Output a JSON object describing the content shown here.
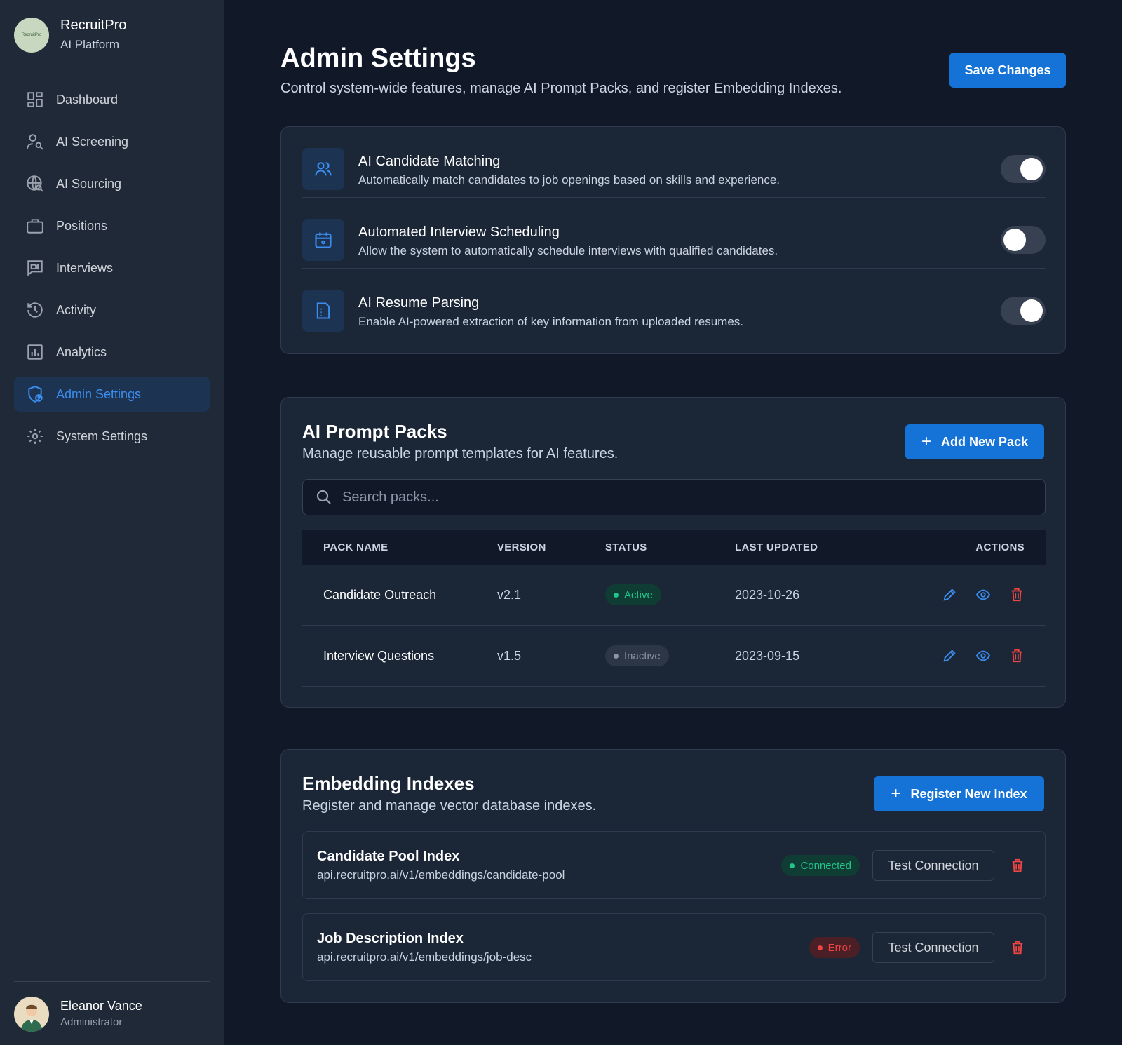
{
  "brand": {
    "logo_text": "RecruitPro",
    "name": "RecruitPro",
    "subtitle": "AI Platform"
  },
  "nav": {
    "items": [
      {
        "label": "Dashboard",
        "icon": "dashboard-icon"
      },
      {
        "label": "AI Screening",
        "icon": "user-search-icon"
      },
      {
        "label": "AI Sourcing",
        "icon": "globe-search-icon"
      },
      {
        "label": "Positions",
        "icon": "briefcase-icon"
      },
      {
        "label": "Interviews",
        "icon": "video-chat-icon"
      },
      {
        "label": "Activity",
        "icon": "history-icon"
      },
      {
        "label": "Analytics",
        "icon": "analytics-icon"
      },
      {
        "label": "Admin Settings",
        "icon": "admin-shield-icon",
        "active": true
      },
      {
        "label": "System Settings",
        "icon": "gear-icon"
      }
    ]
  },
  "user": {
    "name": "Eleanor Vance",
    "role": "Administrator"
  },
  "header": {
    "title": "Admin Settings",
    "subtitle": "Control system-wide features, manage AI Prompt Packs, and register Embedding Indexes.",
    "save_label": "Save Changes"
  },
  "features": [
    {
      "title": "AI Candidate Matching",
      "description": "Automatically match candidates to job openings based on skills and experience.",
      "enabled": true,
      "icon": "users-icon"
    },
    {
      "title": "Automated Interview Scheduling",
      "description": "Allow the system to automatically schedule interviews with qualified candidates.",
      "enabled": false,
      "icon": "calendar-icon"
    },
    {
      "title": "AI Resume Parsing",
      "description": "Enable AI-powered extraction of key information from uploaded resumes.",
      "enabled": true,
      "icon": "document-icon"
    }
  ],
  "prompt_packs": {
    "title": "AI Prompt Packs",
    "subtitle": "Manage reusable prompt templates for AI features.",
    "add_label": "Add New Pack",
    "search_placeholder": "Search packs...",
    "columns": [
      "PACK NAME",
      "VERSION",
      "STATUS",
      "LAST UPDATED",
      "ACTIONS"
    ],
    "rows": [
      {
        "name": "Candidate Outreach",
        "version": "v2.1",
        "status": "Active",
        "updated": "2023-10-26"
      },
      {
        "name": "Interview Questions",
        "version": "v1.5",
        "status": "Inactive",
        "updated": "2023-09-15"
      }
    ]
  },
  "embedding_indexes": {
    "title": "Embedding Indexes",
    "subtitle": "Register and manage vector database indexes.",
    "register_label": "Register New Index",
    "test_label": "Test Connection",
    "items": [
      {
        "name": "Candidate Pool Index",
        "url": "api.recruitpro.ai/v1/embeddings/candidate-pool",
        "status": "Connected"
      },
      {
        "name": "Job Description Index",
        "url": "api.recruitpro.ai/v1/embeddings/job-desc",
        "status": "Error"
      }
    ]
  },
  "colors": {
    "accent": "#1573d8",
    "success": "#22c58b",
    "danger": "#ef4444",
    "background": "#111827",
    "card": "#1b2636"
  }
}
